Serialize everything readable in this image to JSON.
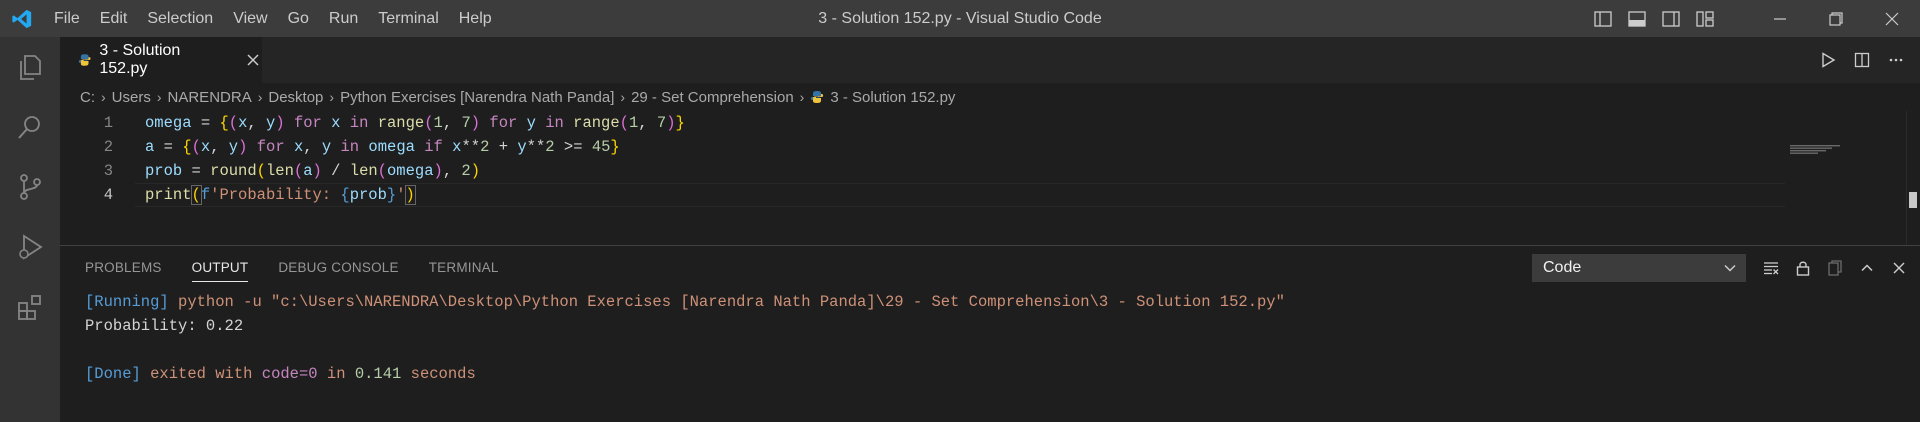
{
  "titlebar": {
    "menu": [
      "File",
      "Edit",
      "Selection",
      "View",
      "Go",
      "Run",
      "Terminal",
      "Help"
    ],
    "window_title": "3 - Solution 152.py - Visual Studio Code"
  },
  "activity_bar": {
    "icons": [
      "files-icon",
      "search-icon",
      "source-control-icon",
      "run-debug-icon",
      "extensions-icon"
    ]
  },
  "editor": {
    "tab_label": "3 - Solution 152.py",
    "breadcrumb": [
      "C:",
      "Users",
      "NARENDRA",
      "Desktop",
      "Python Exercises [Narendra Nath Panda]",
      "29 - Set Comprehension",
      "3 - Solution 152.py"
    ],
    "line_numbers": [
      "1",
      "2",
      "3",
      "4"
    ],
    "active_line": 4
  },
  "panel": {
    "tabs": [
      "PROBLEMS",
      "OUTPUT",
      "DEBUG CONSOLE",
      "TERMINAL"
    ],
    "active_tab": "OUTPUT",
    "output_channel": "Code",
    "output": {
      "running_tag": "[Running]",
      "running_cmd": "python -u \"c:\\Users\\NARENDRA\\Desktop\\Python Exercises [Narendra Nath Panda]\\29 - Set Comprehension\\3 - Solution 152.py\"",
      "result": "Probability: 0.22",
      "done_tag": "[Done]",
      "done_exited": "exited with",
      "done_code": "code=0",
      "done_in": "in",
      "done_time": "0.141",
      "done_seconds": "seconds"
    }
  },
  "colors": {
    "titlebar_bg": "#3c3c3c",
    "activitybar_bg": "#333333",
    "editor_bg": "#1e1e1e",
    "accent_blue": "#0078d4"
  }
}
